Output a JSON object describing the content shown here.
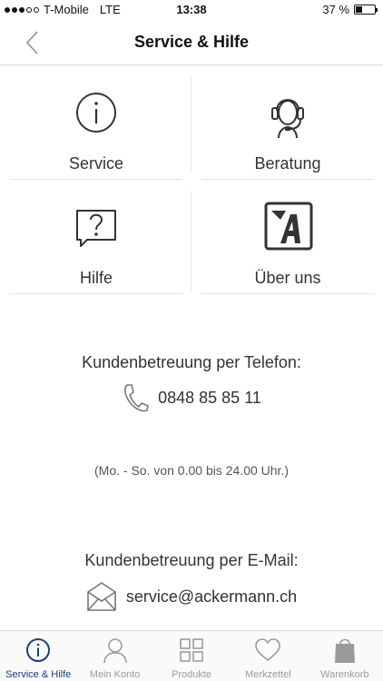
{
  "status_bar": {
    "carrier": "T-Mobile",
    "network": "LTE",
    "time": "13:38",
    "battery": "37 %",
    "battery_level": 0.37,
    "signal_bars_filled": 3,
    "signal_bars_total": 5
  },
  "nav": {
    "title": "Service & Hilfe",
    "back_icon": "chevron-left-icon"
  },
  "tiles": [
    {
      "label": "Service",
      "icon": "info-icon"
    },
    {
      "label": "Beratung",
      "icon": "headset-icon"
    },
    {
      "label": "Hilfe",
      "icon": "question-bubble-icon"
    },
    {
      "label": "Über uns",
      "icon": "ackermann-logo-icon"
    }
  ],
  "contact": {
    "phone_heading": "Kundenbetreuung per Telefon:",
    "phone_number": "0848 85 85 11",
    "hours": "(Mo. - So. von 0.00 bis 24.00 Uhr.)",
    "email_heading": "Kundenbetreuung per E-Mail:",
    "email": "service@ackermann.ch"
  },
  "tab_bar": {
    "active_index": 0,
    "active_color": "#1f3d7a",
    "inactive_color": "#9b9b9b",
    "tabs": [
      {
        "label": "Service & Hilfe",
        "icon": "info-icon"
      },
      {
        "label": "Mein Konto",
        "icon": "person-icon"
      },
      {
        "label": "Produkte",
        "icon": "grid-icon"
      },
      {
        "label": "Merkzettel",
        "icon": "heart-icon"
      },
      {
        "label": "Warenkorb",
        "icon": "shopping-bag-icon"
      }
    ]
  }
}
